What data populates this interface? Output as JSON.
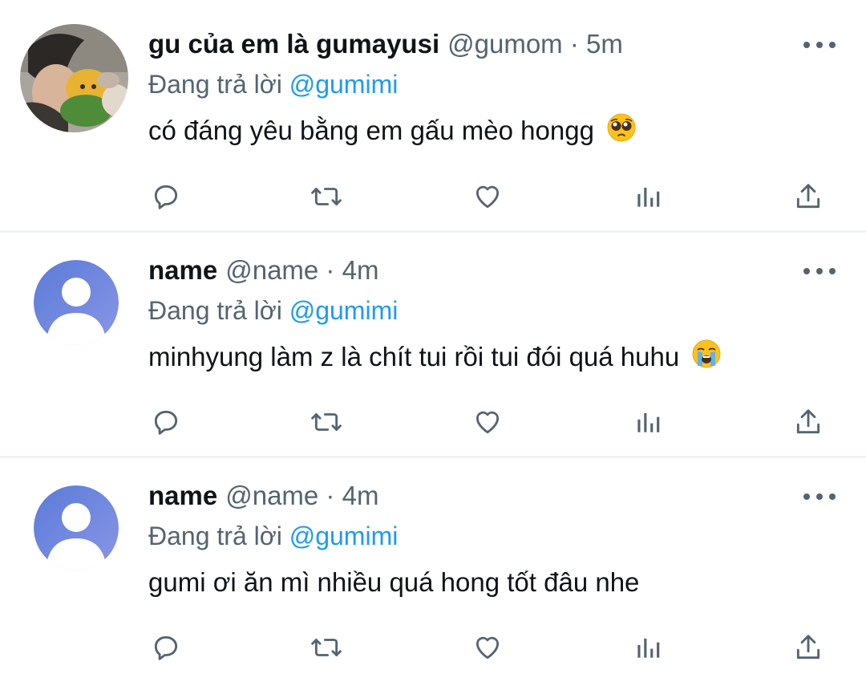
{
  "tweets": [
    {
      "display_name": "gu của em là gumayusi",
      "handle_meta": "@gumom · 5m",
      "reply_prefix": "Đang trả lời",
      "reply_handle": "@gumimi",
      "text": "có đáng yêu bằng em gấu mèo hongg",
      "emoji": "pleading-face-emoji",
      "avatar": "photo-avatar"
    },
    {
      "display_name": "name",
      "handle_meta": "@name · 4m",
      "reply_prefix": "Đang trả lời",
      "reply_handle": "@gumimi",
      "text": "minhyung làm z là chít tui rồi tui đói quá huhu",
      "emoji": "loudly-crying-face-emoji",
      "avatar": "default-avatar"
    },
    {
      "display_name": "name",
      "handle_meta": "@name · 4m",
      "reply_prefix": "Đang trả lời",
      "reply_handle": "@gumimi",
      "text": "gumi ơi ăn mì nhiều quá hong tốt đâu nhe",
      "emoji": "",
      "avatar": "default-avatar"
    }
  ],
  "action_icons": [
    "reply-icon",
    "retweet-icon",
    "like-icon",
    "views-icon",
    "share-icon"
  ],
  "colors": {
    "link": "#1d9bf0",
    "secondary_text": "#536471",
    "primary_text": "#0f1419",
    "divider": "#eff3f4",
    "default_avatar_gradient": [
      "#5a7bd8",
      "#8a96e6"
    ]
  }
}
